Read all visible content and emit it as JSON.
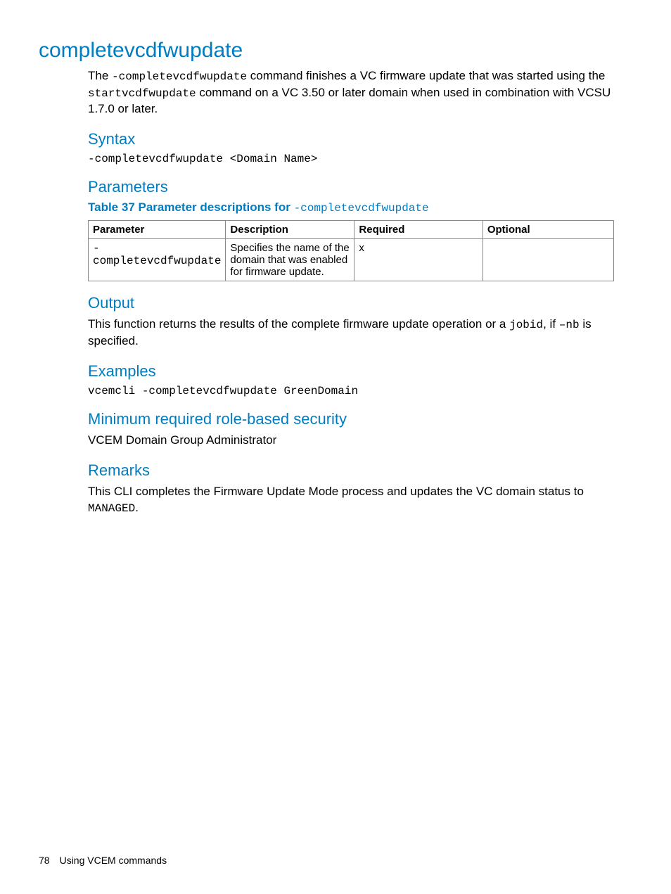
{
  "title": "completevcdfwupdate",
  "intro": {
    "t1": "The ",
    "c1": "-completevcdfwupdate",
    "t2": " command finishes a VC firmware update that was started using the ",
    "c2": "startvcdfwupdate",
    "t3": " command on a VC 3.50 or later domain when used in combination with VCSU 1.7.0 or later."
  },
  "syntax": {
    "heading": "Syntax",
    "cmd": "-completevcdfwupdate <Domain Name>"
  },
  "parameters": {
    "heading": "Parameters",
    "captionPrefix": "Table 37 Parameter descriptions for ",
    "captionCmd": "-completevcdfwupdate",
    "headers": {
      "parameter": "Parameter",
      "description": "Description",
      "required": "Required",
      "optional": "Optional"
    },
    "rows": [
      {
        "parameter": "-completevcdfwupdate",
        "description": "Specifies the name of the domain that was enabled for firmware update.",
        "required": "x",
        "optional": ""
      }
    ]
  },
  "output": {
    "heading": "Output",
    "t1": "This function returns the results of the complete firmware update operation or a ",
    "c1": "jobid",
    "t2": ", if ",
    "c2": "–nb",
    "t3": " is specified."
  },
  "examples": {
    "heading": "Examples",
    "cmd": "vcemcli -completevcdfwupdate GreenDomain"
  },
  "security": {
    "heading": "Minimum required role-based security",
    "text": "VCEM Domain Group Administrator"
  },
  "remarks": {
    "heading": "Remarks",
    "t1": "This CLI completes the Firmware Update Mode process and updates the VC domain status to ",
    "c1": "MANAGED",
    "t2": "."
  },
  "footer": {
    "page": "78",
    "section": "Using VCEM commands"
  }
}
